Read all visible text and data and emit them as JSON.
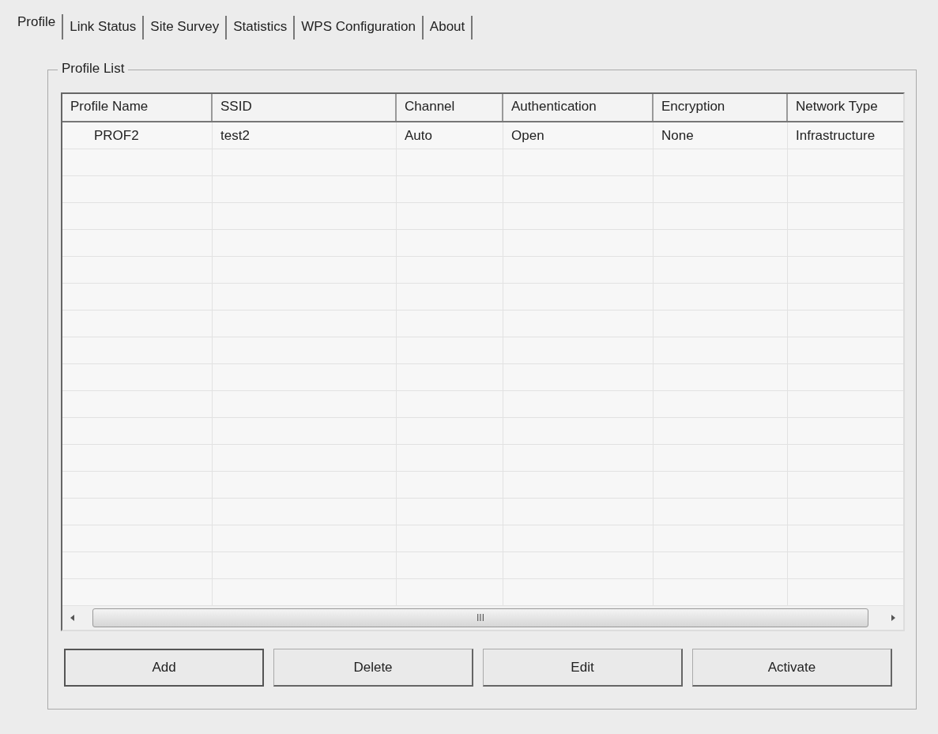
{
  "tabs": [
    {
      "label": "Profile",
      "selected": true
    },
    {
      "label": "Link Status",
      "selected": false
    },
    {
      "label": "Site Survey",
      "selected": false
    },
    {
      "label": "Statistics",
      "selected": false
    },
    {
      "label": "WPS Configuration",
      "selected": false
    },
    {
      "label": "About",
      "selected": false
    }
  ],
  "profile_list": {
    "title": "Profile List",
    "columns": [
      "Profile Name",
      "SSID",
      "Channel",
      "Authentication",
      "Encryption",
      "Network Type"
    ],
    "rows": [
      {
        "cells": [
          "PROF2",
          "test2",
          "Auto",
          "Open",
          "None",
          "Infrastructure"
        ]
      }
    ],
    "scroll_grip": "III"
  },
  "buttons": [
    "Add",
    "Delete",
    "Edit",
    "Activate"
  ]
}
